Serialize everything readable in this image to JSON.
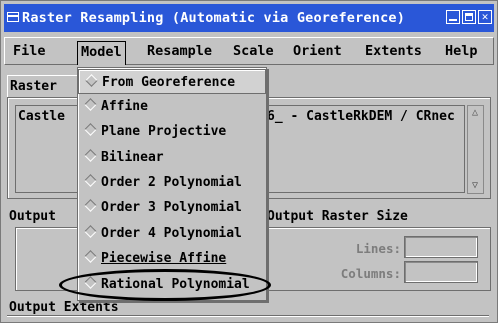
{
  "window": {
    "title": "Raster Resampling (Automatic via Georeference)"
  },
  "menubar": {
    "items": [
      "File",
      "Model",
      "Resample",
      "Scale",
      "Orient",
      "Extents",
      "Help"
    ]
  },
  "raster_panel": {
    "label": "Raster",
    "row_prefix": "Castle",
    "row_suffix": "6_ - CastleRkDEM / CRnec"
  },
  "output_panel": {
    "label": "Output"
  },
  "output_size": {
    "label": "Output Raster Size",
    "lines_label": "Lines:",
    "columns_label": "Columns:",
    "lines_value": "",
    "columns_value": ""
  },
  "extents": {
    "label": "Output Extents"
  },
  "model_menu": {
    "items": [
      "From Georeference",
      "Affine",
      "Plane Projective",
      "Bilinear",
      "Order 2 Polynomial",
      "Order 3 Polynomial",
      "Order 4 Polynomial",
      "Piecewise Affine",
      "Rational Polynomial"
    ],
    "selected_index": 0,
    "highlighted_item": "Rational Polynomial"
  },
  "colors": {
    "titlebar": "#2a57d8",
    "panel": "#c3c3c3"
  }
}
